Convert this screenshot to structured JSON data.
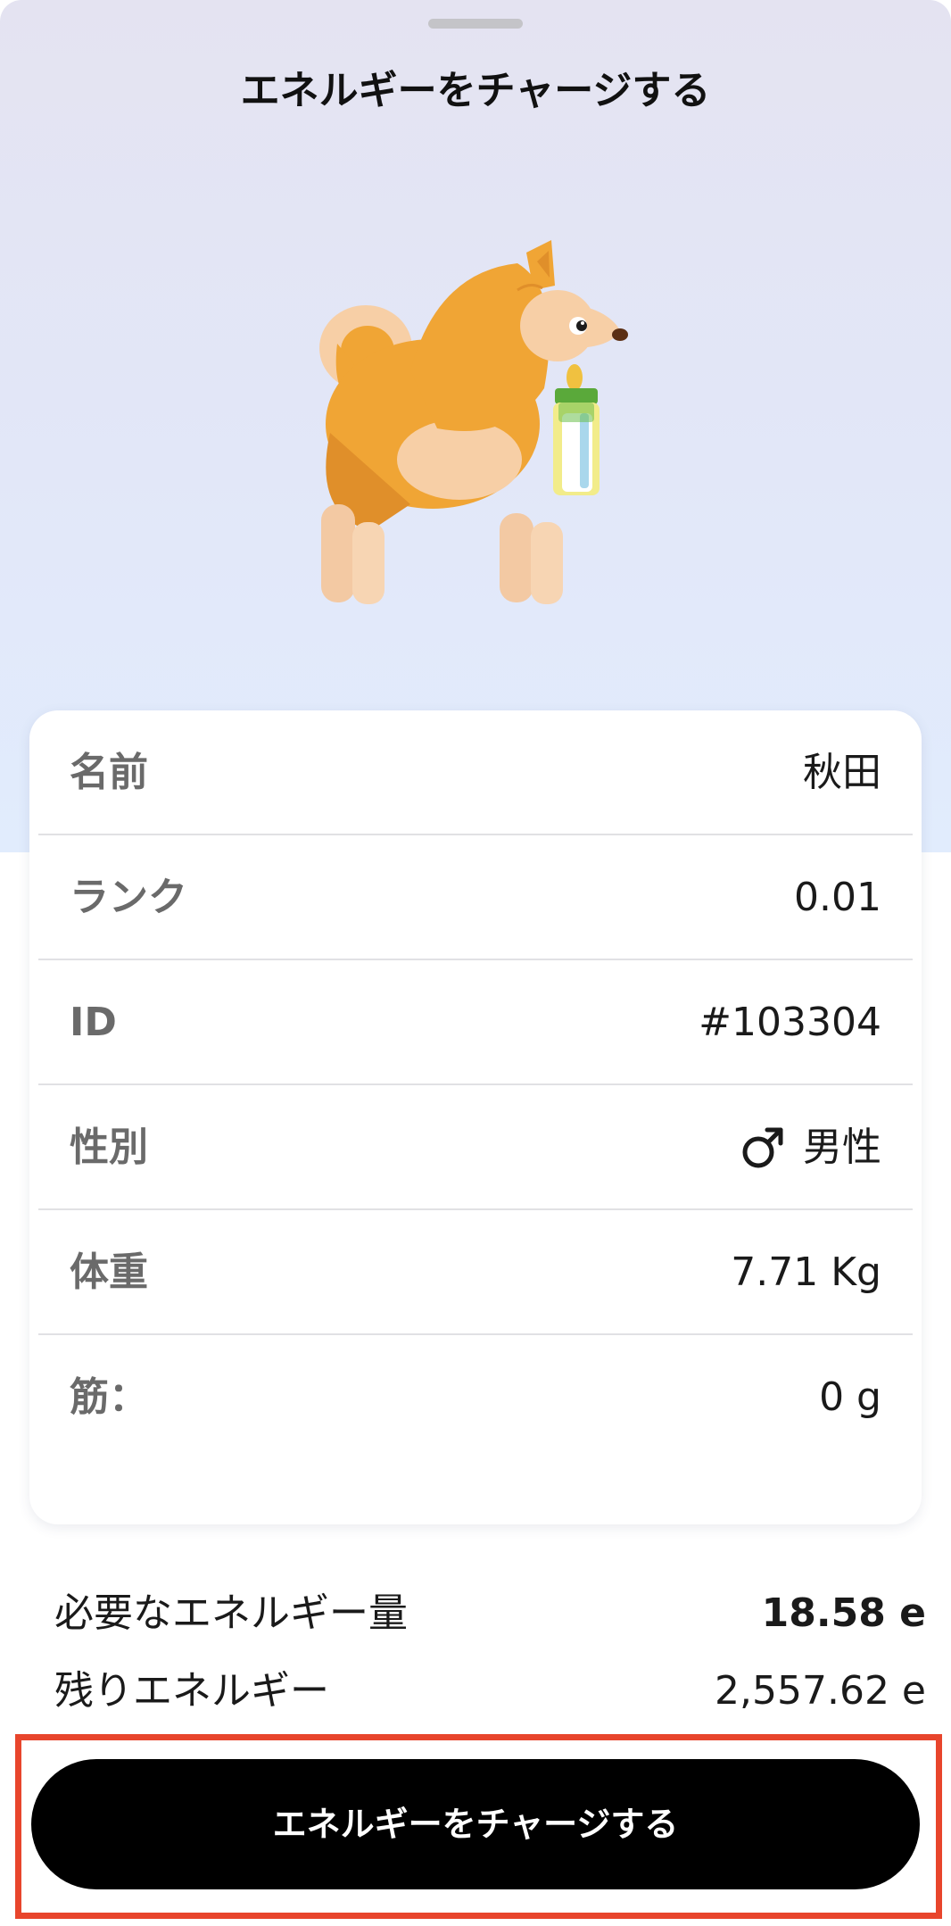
{
  "sheet": {
    "title": "エネルギーをチャージする"
  },
  "pet_info": {
    "rows": [
      {
        "label": "名前",
        "value": "秋田"
      },
      {
        "label": "ランク",
        "value": "0.01"
      },
      {
        "label": "ID",
        "value": "#103304"
      },
      {
        "label": "性別",
        "value": "男性",
        "icon": "male-symbol-icon"
      },
      {
        "label": "体重",
        "value": "7.71 Kg"
      },
      {
        "label": "筋：",
        "value": "0 g"
      }
    ]
  },
  "energy": {
    "required_label": "必要なエネルギー量",
    "required_value": "18.58 e",
    "remaining_label": "残りエネルギー",
    "remaining_value": "2,557.62 e"
  },
  "action": {
    "charge_label": "エネルギーをチャージする",
    "highlight_color": "#e8452c"
  },
  "colors": {
    "accent": "#000000",
    "dog_fur": "#f0a535",
    "bottle_cap": "#5aa93a"
  }
}
